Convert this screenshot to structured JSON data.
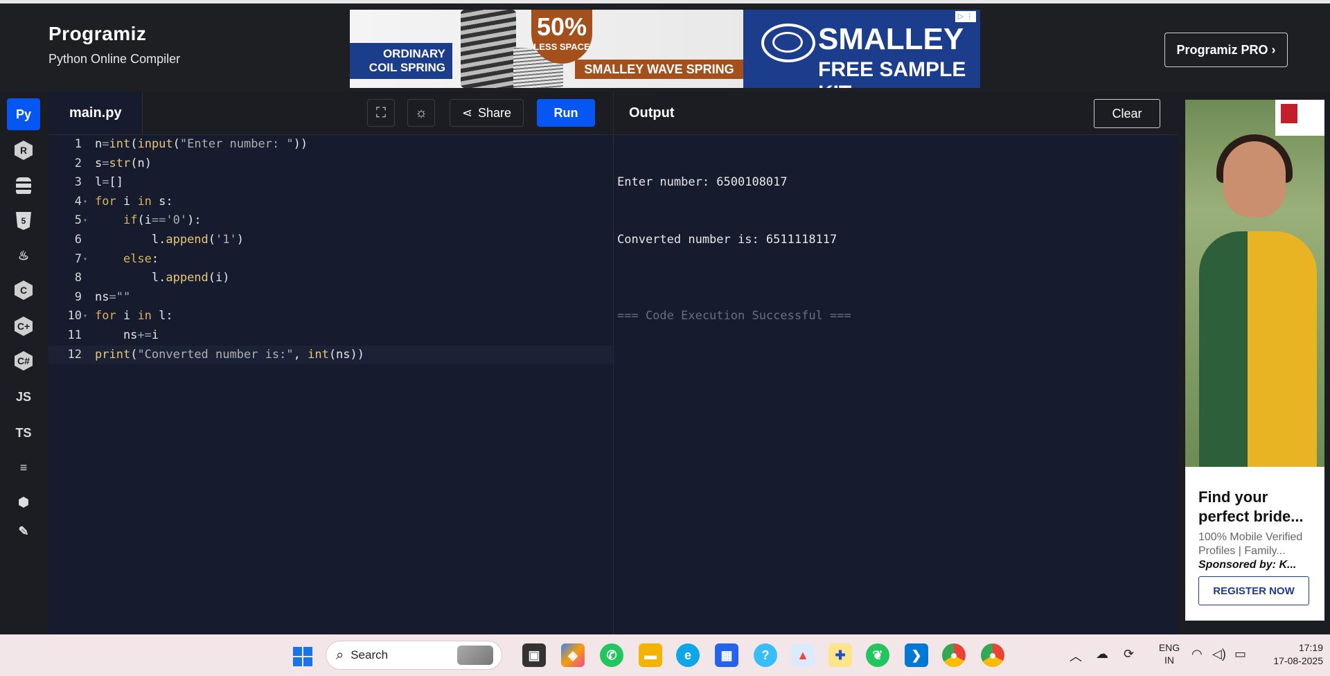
{
  "header": {
    "brand": "Programiz",
    "subtitle": "Python Online Compiler",
    "pro_button": "Programiz PRO ›"
  },
  "top_ad": {
    "left_label": "ORDINARY\nCOIL SPRING",
    "badge_big": "50%",
    "badge_small": "LESS SPACE",
    "wave_label": "SMALLEY WAVE SPRING",
    "brand": "SMALLEY",
    "cta": "FREE SAMPLE KIT"
  },
  "sidebar": {
    "items": [
      {
        "name": "python",
        "label": "Py",
        "icon": "python-icon"
      },
      {
        "name": "r",
        "label": "R",
        "icon": "r-icon"
      },
      {
        "name": "sql",
        "label": "",
        "icon": "database-icon"
      },
      {
        "name": "html",
        "label": "5",
        "icon": "html5-icon"
      },
      {
        "name": "java",
        "label": "♨",
        "icon": "java-icon"
      },
      {
        "name": "c",
        "label": "C",
        "icon": "c-icon"
      },
      {
        "name": "cpp",
        "label": "C+",
        "icon": "cpp-icon"
      },
      {
        "name": "csharp",
        "label": "C#",
        "icon": "csharp-icon"
      },
      {
        "name": "js",
        "label": "JS",
        "icon": "js-icon"
      },
      {
        "name": "ts",
        "label": "TS",
        "icon": "ts-icon"
      },
      {
        "name": "go",
        "label": "≡",
        "icon": "go-icon"
      },
      {
        "name": "php",
        "label": "⬢",
        "icon": "php-icon"
      },
      {
        "name": "more",
        "label": "✎",
        "icon": "more-icon"
      }
    ]
  },
  "editor": {
    "file_tab": "main.py",
    "share_label": "Share",
    "run_label": "Run",
    "lines": [
      {
        "n": "1",
        "code": "n=int(input(\"Enter number: \"))",
        "fold": false
      },
      {
        "n": "2",
        "code": "s=str(n)",
        "fold": false
      },
      {
        "n": "3",
        "code": "l=[]",
        "fold": false
      },
      {
        "n": "4",
        "code": "for i in s:",
        "fold": true
      },
      {
        "n": "5",
        "code": "    if(i=='0'):",
        "fold": true
      },
      {
        "n": "6",
        "code": "        l.append('1')",
        "fold": false
      },
      {
        "n": "7",
        "code": "    else:",
        "fold": true
      },
      {
        "n": "8",
        "code": "        l.append(i)",
        "fold": false
      },
      {
        "n": "9",
        "code": "ns=\"\"",
        "fold": false
      },
      {
        "n": "10",
        "code": "for i in l:",
        "fold": true
      },
      {
        "n": "11",
        "code": "    ns+=i",
        "fold": false
      },
      {
        "n": "12",
        "code": "print(\"Converted number is:\", int(ns))",
        "fold": false
      }
    ]
  },
  "output": {
    "title": "Output",
    "clear_label": "Clear",
    "lines": [
      "Enter number: 6500108017",
      "Converted number is: 6511118117"
    ],
    "status": "=== Code Execution Successful ==="
  },
  "side_ad": {
    "headline": "Find your perfect bride...",
    "meta": "100% Mobile Verified Profiles | Family...",
    "sponsor": "Sponsored by: K...",
    "cta": "REGISTER NOW"
  },
  "taskbar": {
    "search_placeholder": "Search",
    "lang_line1": "ENG",
    "lang_line2": "IN",
    "time": "17:19",
    "date": "17-08-2025"
  }
}
